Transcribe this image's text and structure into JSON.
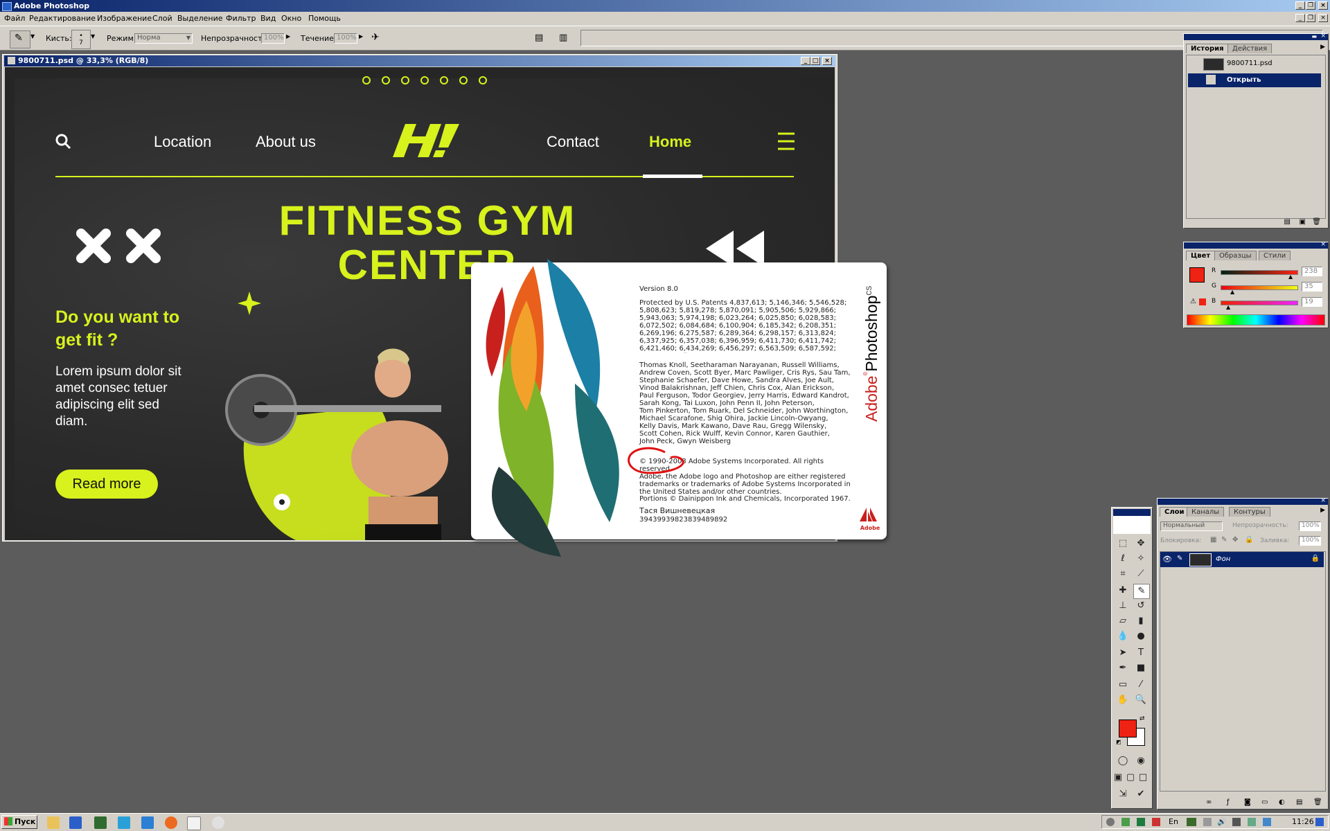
{
  "app": {
    "title": "Adobe Photoshop"
  },
  "menu": [
    "Файл",
    "Редактирование",
    "Изображение",
    "Слой",
    "Выделение",
    "Фильтр",
    "Вид",
    "Окно",
    "Помощь"
  ],
  "options": {
    "brush_label": "Кисть:",
    "brush_size": "7",
    "mode_label": "Режим:",
    "mode_value": "Норма",
    "opacity_label": "Непрозрачность:",
    "opacity_value": "100%",
    "flow_label": "Течение:",
    "flow_value": "100%"
  },
  "document": {
    "title": "9800711.psd @ 33,3% (RGB/8)",
    "design": {
      "nav_left": [
        "Location",
        "About us"
      ],
      "nav_right": [
        "Contact",
        "Home"
      ],
      "logo": "H!",
      "hero_line1": "FITNESS GYM",
      "hero_line2": "CENTER",
      "heading": "Do you want to get fit ?",
      "body": "Lorem ipsum dolor sit amet consec tetuer adipiscing elit sed diam.",
      "cta": "Read more",
      "accent": "#d7f21c"
    }
  },
  "about": {
    "version": "Version 8.0",
    "patents": "Protected by U.S. Patents 4,837,613; 5,146,346; 5,546,528;\n5,808,623; 5,819,278; 5,870,091; 5,905,506; 5,929,866;\n5,943,063; 5,974,198; 6,023,264; 6,025,850; 6,028,583;\n6,072,502; 6,084,684; 6,100,904; 6,185,342; 6,208,351;\n6,269,196; 6,275,587; 6,289,364; 6,298,157; 6,313,824;\n6,337,925; 6,357,038; 6,396,959; 6,411,730; 6,411,742;\n6,421,460; 6,434,269; 6,456,297; 6,563,509; 6,587,592;\npatents pending",
    "credits": "Thomas Knoll, Seetharaman Narayanan, Russell Williams,\nAndrew Coven, Scott Byer, Marc Pawliger, Cris Rys, Sau Tam,\nStephanie Schaefer, Dave Howe, Sandra Alves, Joe Ault,\nVinod Balakrishnan, Jeff Chien, Chris Cox, Alan Erickson,\nPaul Ferguson, Todor Georgiev, Jerry Harris, Edward Kandrot,\nSarah Kong, Tai Luxon, John Penn II, John Peterson,\nTom Pinkerton, Tom Ruark, Del Schneider, John Worthington,\nMichael Scarafone, Shig Ohira, Jackie Lincoln-Owyang,\nKelly Davis, Mark Kawano, Dave Rau, Gregg Wilensky,\nScott Cohen, Rick Wulff, Kevin Connor, Karen Gauthier,\nJohn Peck, Gwyn Weisberg",
    "copyright": "© 1990-2003 Adobe Systems Incorporated. All rights reserved.\nAdobe, the Adobe logo and Photoshop are either registered\ntrademarks or trademarks of Adobe Systems Incorporated in\nthe United States and/or other countries.",
    "portions": "Portions © Dainippon Ink and Chemicals, Incorporated 1967.",
    "user_name": "Тася Вишневецкая",
    "serial": "39439939823839489892",
    "product_name": "Adobe Photoshop",
    "product_suffix": "cs",
    "adobe_label": "Adobe"
  },
  "history_panel": {
    "tabs": [
      "История",
      "Действия"
    ],
    "snapshot": "9800711.psd",
    "items": [
      "Открыть"
    ]
  },
  "color_panel": {
    "tabs": [
      "Цвет",
      "Образцы",
      "Стили"
    ],
    "r_label": "R",
    "g_label": "G",
    "b_label": "B",
    "r": "238",
    "g": "35",
    "b": "19",
    "foreground": "#ee2313"
  },
  "layers_panel": {
    "tabs": [
      "Слои",
      "Каналы",
      "Контуры"
    ],
    "blend_mode": "Нормальный",
    "opacity_label": "Непрозрачность:",
    "opacity_value": "100%",
    "lock_label": "Блокировка:",
    "fill_label": "Заливка:",
    "fill_value": "100%",
    "layers": [
      "Фон"
    ]
  },
  "taskbar": {
    "start": "Пуск",
    "lang": "En",
    "time": "11:26"
  }
}
